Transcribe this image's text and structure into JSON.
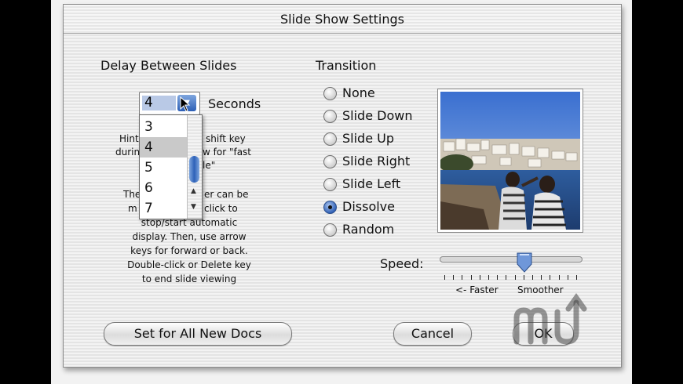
{
  "window": {
    "title": "Slide Show Settings"
  },
  "delay": {
    "heading": "Delay Between Slides",
    "value": "4",
    "unit_label": "Seconds",
    "options": [
      "3",
      "4",
      "5",
      "6",
      "7"
    ],
    "selected_option": "4"
  },
  "hint_lines": [
    {
      "left": "Hint",
      "right": "shift key"
    },
    {
      "left": "durin",
      "right": "w for \"fast"
    },
    {
      "left": "",
      "right": "le\""
    },
    {
      "left": "The",
      "right": "er can be"
    },
    {
      "left": "m",
      "right": "click to"
    }
  ],
  "help_lines": [
    "stop/start automatic",
    "display. Then, use arrow",
    "keys for forward or back.",
    "Double-click or Delete key",
    "to end slide viewing"
  ],
  "transition": {
    "heading": "Transition",
    "options": [
      "None",
      "Slide Down",
      "Slide Up",
      "Slide Right",
      "Slide Left",
      "Dissolve",
      "Random"
    ],
    "selected": "Dissolve"
  },
  "speed": {
    "label": "Speed:",
    "left_caption": "<- Faster",
    "right_caption": "Smoother",
    "value": 0.6,
    "tick_count": 16
  },
  "buttons": {
    "set_all": "Set for All New Docs",
    "cancel": "Cancel",
    "ok": "OK"
  },
  "colors": {
    "accent_blue": "#2c5fb6",
    "selection": "#b9c9e6"
  },
  "icons": {
    "delay_arrow": "popup-arrow-icon",
    "watermark": "macupdate-logo-icon"
  }
}
